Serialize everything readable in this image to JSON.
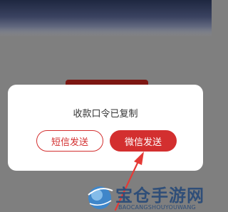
{
  "dialog": {
    "message": "收款口令已复制",
    "sms_button": "短信发送",
    "wechat_button": "微信发送"
  },
  "watermark": {
    "title": "宝仓手游网",
    "subtitle": "BAOCANGSHOUYOUWANG"
  },
  "colors": {
    "accent": "#d32f2f",
    "overlay": "#7f7f7f",
    "arrow": "#e53935",
    "watermark": "#2f4e78"
  },
  "icons": [
    "annotation-arrow-icon",
    "watermark-logo-icon"
  ]
}
